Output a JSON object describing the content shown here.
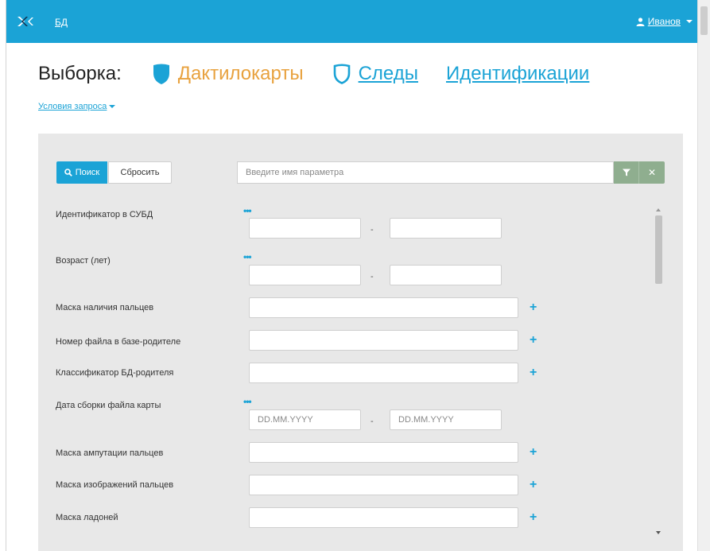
{
  "topbar": {
    "nav_link": "БД",
    "user_name": "Иванов",
    "icons": [
      "logo-icon",
      "user-icon"
    ]
  },
  "heading": {
    "selection_label": "Выборка:",
    "tabs": [
      {
        "label": "Дактилокарты",
        "active": true,
        "icon": "shield-filled-icon"
      },
      {
        "label": "Следы",
        "active": false,
        "icon": "shield-outline-icon"
      },
      {
        "label": "Идентификации",
        "active": false
      }
    ]
  },
  "query_conditions": "Условия запроса",
  "toolbar": {
    "search_label": "Поиск",
    "reset_label": "Сбросить",
    "param_placeholder": "Введите имя параметра"
  },
  "form": {
    "fields": [
      {
        "label": "Идентификатор в СУБД",
        "type": "range"
      },
      {
        "label": "Возраст (лет)",
        "type": "range"
      },
      {
        "label": "Маска наличия пальцев",
        "type": "text"
      },
      {
        "label": "Номер файла в базе-родителе",
        "type": "text"
      },
      {
        "label": "Классификатор БД-родителя",
        "type": "text"
      },
      {
        "label": "Дата сборки файла карты",
        "type": "date-range",
        "placeholder_from": "DD.MM.YYYY",
        "placeholder_to": "DD.MM.YYYY"
      },
      {
        "label": "Маска ампутации пальцев",
        "type": "text"
      },
      {
        "label": "Маска изображений пальцев",
        "type": "text"
      },
      {
        "label": "Маска ладоней",
        "type": "text"
      }
    ],
    "range_separator": "-",
    "more_glyph": "•••",
    "add_glyph": "+"
  },
  "colors": {
    "accent": "#1ba3d6",
    "active_tab": "#e8a23f",
    "panel_bg": "#e8e8e8",
    "filter_btn": "#8fae8f"
  }
}
